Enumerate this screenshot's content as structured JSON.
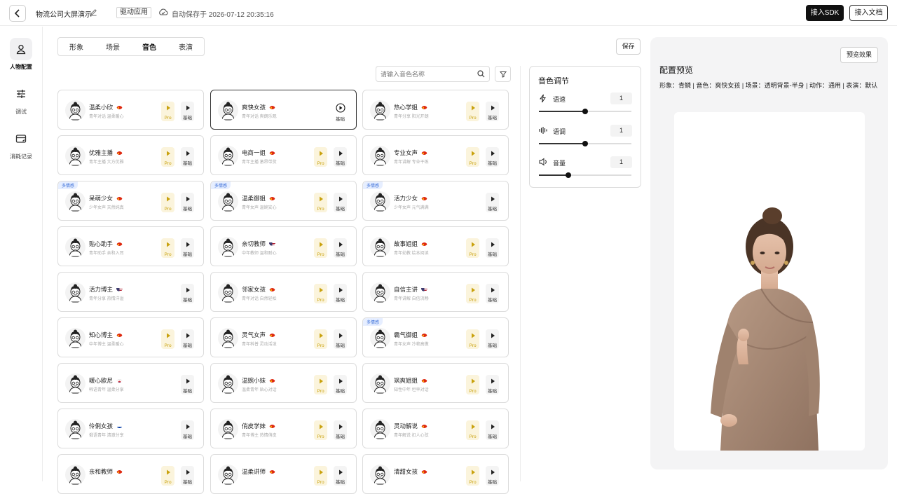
{
  "header": {
    "project_title": "物流公司大屏演示",
    "drive_tag": "驱动应用",
    "autosave_text": "自动保存于 2026-07-12 20:35:16",
    "sdk_button": "接入SDK",
    "doc_button": "接入文档"
  },
  "sidebar": {
    "items": [
      {
        "label": "人物配置",
        "icon": "person-icon",
        "active": true
      },
      {
        "label": "调试",
        "icon": "sliders-icon",
        "active": false
      },
      {
        "label": "消耗记录",
        "icon": "card-icon",
        "active": false
      }
    ]
  },
  "tabs": [
    "形象",
    "场景",
    "音色",
    "表演"
  ],
  "active_tab": "音色",
  "save_button": "保存",
  "search": {
    "placeholder": "请输入音色名称"
  },
  "multi_emotion_tag": "多情感",
  "pro_label": "Pro",
  "basic_label": "基础",
  "voices": [
    {
      "name": "温柔小欣",
      "desc": "青年对话 温柔暖心",
      "flag": "cn",
      "pro": true,
      "multi": false
    },
    {
      "name": "爽快女孩",
      "desc": "青年对话 爽朗乐观",
      "flag": "cn",
      "pro": false,
      "multi": false,
      "selected": true
    },
    {
      "name": "热心学姐",
      "desc": "青年分享 阳光开朗",
      "flag": "cn",
      "pro": true,
      "multi": false
    },
    {
      "name": "优雅主播",
      "desc": "青年主播 大方优雅",
      "flag": "cn",
      "pro": true,
      "multi": false
    },
    {
      "name": "电商一姐",
      "desc": "青年主播 激昂带货",
      "flag": "cn",
      "pro": true,
      "multi": false
    },
    {
      "name": "专业女声",
      "desc": "青年讲解 专业干练",
      "flag": "cn",
      "pro": true,
      "multi": false
    },
    {
      "name": "呆萌少女",
      "desc": "少年女声 天然纯真",
      "flag": "cn",
      "pro": true,
      "multi": true
    },
    {
      "name": "温柔御姐",
      "desc": "青年女声 温婉安心",
      "flag": "cn",
      "pro": true,
      "multi": true
    },
    {
      "name": "活力少女",
      "desc": "少年女声 元气满满",
      "flag": "cn",
      "pro": false,
      "multi": true
    },
    {
      "name": "贴心助手",
      "desc": "青年助手 亲和入耳",
      "flag": "cn",
      "pro": true,
      "multi": false
    },
    {
      "name": "亲切教师",
      "desc": "中年教师 温和耐心",
      "flag": "us",
      "pro": true,
      "multi": false
    },
    {
      "name": "故事姐姐",
      "desc": "青年幼教 绘本阅读",
      "flag": "cn",
      "pro": true,
      "multi": false
    },
    {
      "name": "活力博主",
      "desc": "青年分享 热情洋溢",
      "flag": "us",
      "pro": false,
      "multi": false
    },
    {
      "name": "邻家女孩",
      "desc": "青年对话 自然轻松",
      "flag": "cn",
      "pro": true,
      "multi": false
    },
    {
      "name": "自信主讲",
      "desc": "青年讲解 自信流畅",
      "flag": "us",
      "pro": true,
      "multi": false
    },
    {
      "name": "知心博主",
      "desc": "中年博主 温柔暖心",
      "flag": "cn",
      "pro": true,
      "multi": false
    },
    {
      "name": "灵气女声",
      "desc": "青年科普 灵动活泼",
      "flag": "cn",
      "pro": true,
      "multi": false
    },
    {
      "name": "霸气御姐",
      "desc": "青年女声 冷艳高傲",
      "flag": "cn",
      "pro": true,
      "multi": true
    },
    {
      "name": "暖心欧尼",
      "desc": "韩语青年 温柔分享",
      "flag": "kr",
      "pro": false,
      "multi": false
    },
    {
      "name": "温婉小妹",
      "desc": "温柔青年 贴心对话",
      "flag": "cn",
      "pro": true,
      "multi": false
    },
    {
      "name": "飒爽姐姐",
      "desc": "知性中年 坦率对话",
      "flag": "cn",
      "pro": true,
      "multi": false
    },
    {
      "name": "伶俐女孩",
      "desc": "俄语青年 清澈分享",
      "flag": "ru",
      "pro": false,
      "multi": false
    },
    {
      "name": "俏皮学妹",
      "desc": "青年博主 热情俏皮",
      "flag": "cn",
      "pro": true,
      "multi": false
    },
    {
      "name": "灵动解说",
      "desc": "青年解说 扣人心弦",
      "flag": "cn",
      "pro": true,
      "multi": false
    },
    {
      "name": "亲和教师",
      "desc": "",
      "flag": "cn",
      "pro": true,
      "multi": false
    },
    {
      "name": "温柔讲师",
      "desc": "",
      "flag": "cn",
      "pro": true,
      "multi": false
    },
    {
      "name": "清甜女孩",
      "desc": "",
      "flag": "cn",
      "pro": true,
      "multi": false
    }
  ],
  "adjust": {
    "title": "音色调节",
    "rows": [
      {
        "label": "语速",
        "value": "1",
        "icon": "lightning-icon",
        "level": 0.5
      },
      {
        "label": "语调",
        "value": "1",
        "icon": "waveform-icon",
        "level": 0.5
      },
      {
        "label": "音量",
        "value": "1",
        "icon": "speaker-icon",
        "level": 0.32
      }
    ]
  },
  "preview": {
    "button": "预览效果",
    "title": "配置预览",
    "summary": "形象：青鳞 | 音色：爽快女孩 | 场景：透明背景-半身 | 动作：通用 | 表演：默认"
  },
  "colors": {
    "pro_bg": "#fbf4dc",
    "pro_text": "#c9a20e",
    "accent_dark": "#111111",
    "tag_blue": "#3b6fd8"
  }
}
